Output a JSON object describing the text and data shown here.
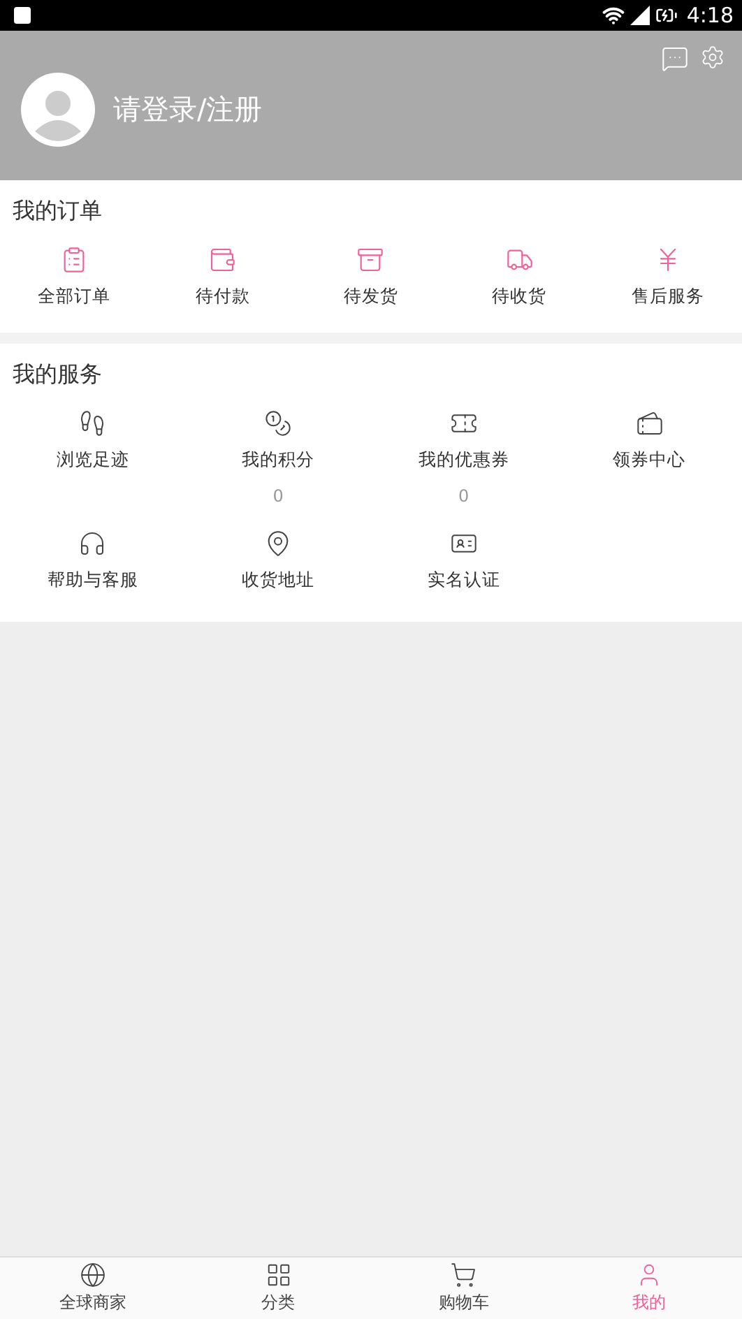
{
  "status_bar": {
    "time": "4:18"
  },
  "header": {
    "login": "请登录/注册"
  },
  "orders": {
    "title": "我的订单",
    "items": [
      {
        "label": "全部订单"
      },
      {
        "label": "待付款"
      },
      {
        "label": "待发货"
      },
      {
        "label": "待收货"
      },
      {
        "label": "售后服务"
      }
    ]
  },
  "services": {
    "title": "我的服务",
    "items": [
      {
        "label": "浏览足迹"
      },
      {
        "label": "我的积分",
        "count": "0"
      },
      {
        "label": "我的优惠券",
        "count": "0"
      },
      {
        "label": "领券中心"
      },
      {
        "label": "帮助与客服"
      },
      {
        "label": "收货地址"
      },
      {
        "label": "实名认证"
      }
    ]
  },
  "bottom_nav": [
    {
      "label": "全球商家",
      "selected": false
    },
    {
      "label": "分类",
      "selected": false
    },
    {
      "label": "购物车",
      "selected": false
    },
    {
      "label": "我的",
      "selected": true
    }
  ]
}
